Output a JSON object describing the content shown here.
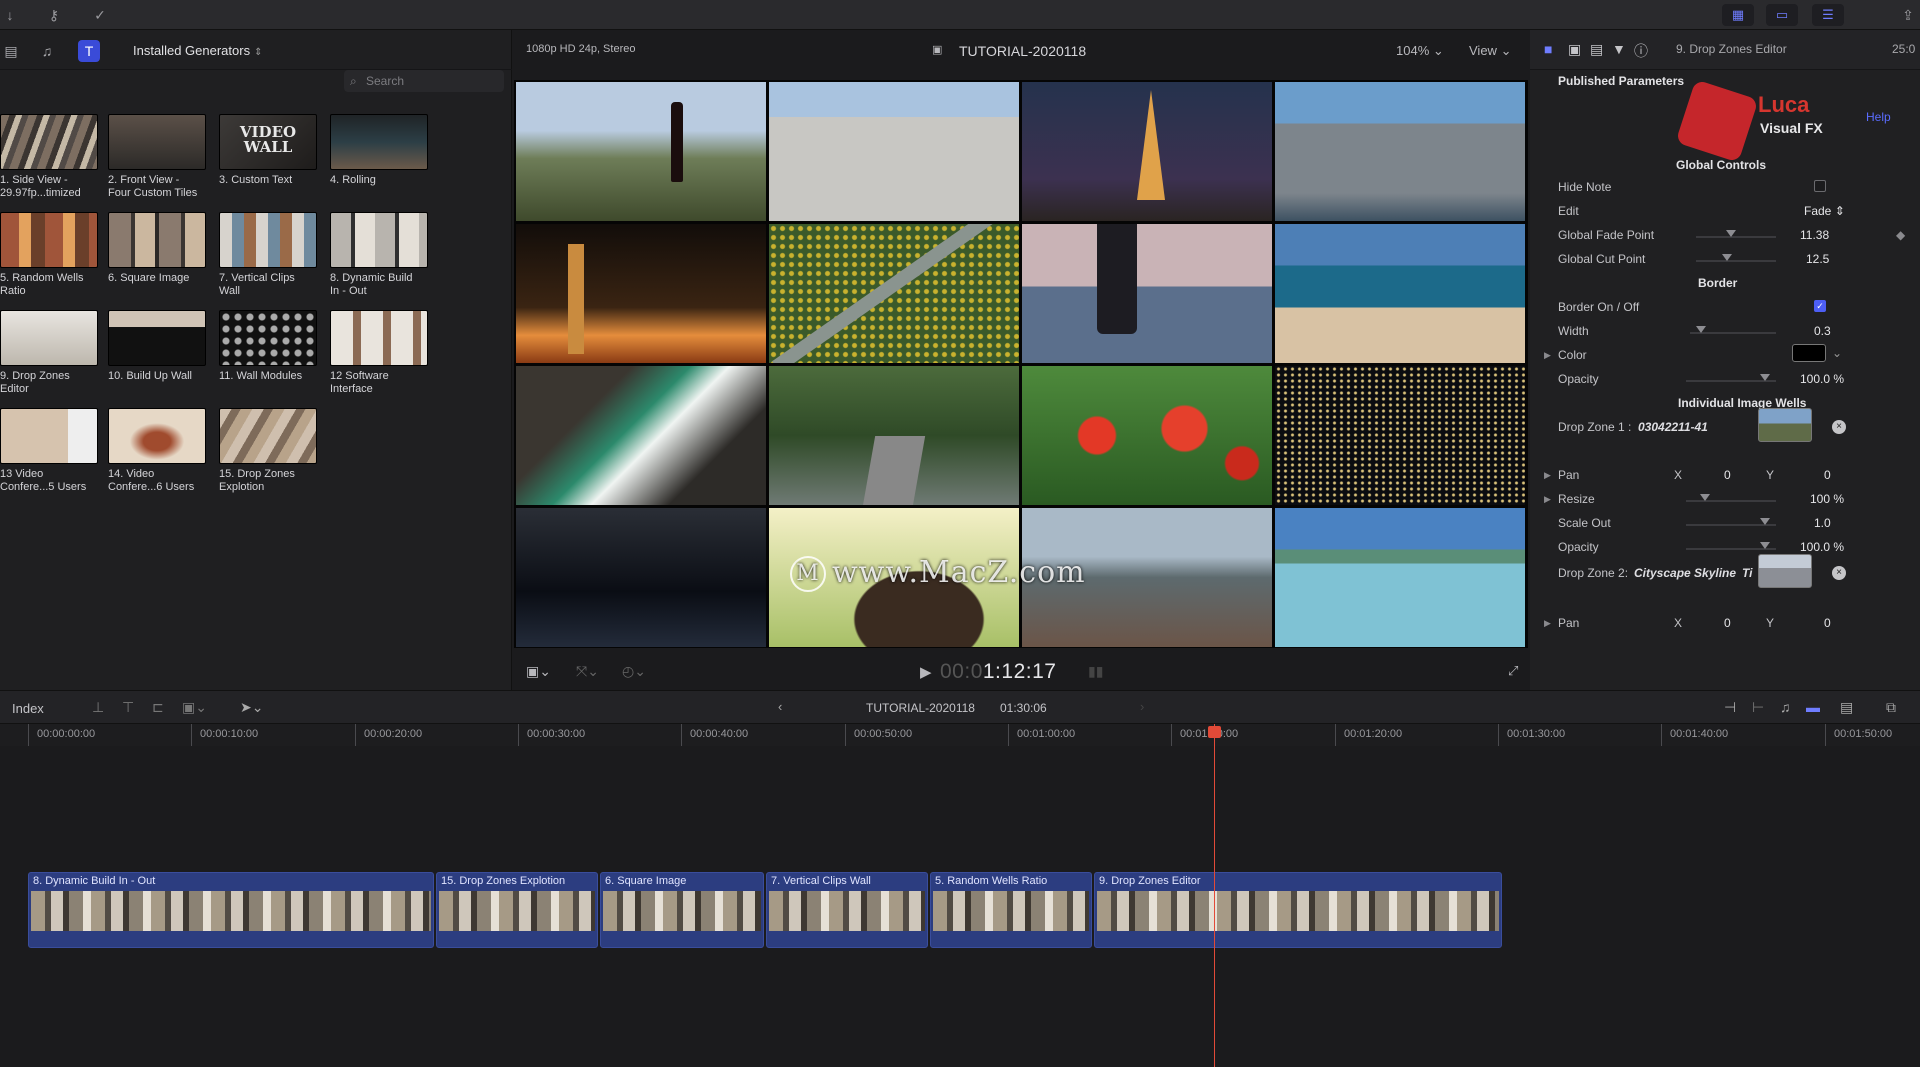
{
  "browser": {
    "category": "Installed Generators",
    "search_placeholder": "Search",
    "generators": [
      {
        "label": "1. Side View -\n29.97fp...timized"
      },
      {
        "label": "2. Front View -\nFour Custom Tiles"
      },
      {
        "label": "3. Custom Text",
        "thumb_text": "VIDEO WALL"
      },
      {
        "label": "4. Rolling"
      },
      {
        "label": "5. Random Wells\nRatio"
      },
      {
        "label": "6. Square Image"
      },
      {
        "label": "7. Vertical Clips\nWall"
      },
      {
        "label": "8. Dynamic Build\nIn - Out"
      },
      {
        "label": "9. Drop Zones\nEditor"
      },
      {
        "label": "10. Build Up Wall"
      },
      {
        "label": "11. Wall Modules"
      },
      {
        "label": "12 Software\nInterface"
      },
      {
        "label": "13 Video\nConfere...5 Users"
      },
      {
        "label": "14. Video\nConfere...6 Users"
      },
      {
        "label": "15. Drop Zones\nExplotion"
      }
    ]
  },
  "viewer": {
    "format": "1080p HD 24p, Stereo",
    "project": "TUTORIAL-2020118",
    "zoom": "104%",
    "view_menu": "View",
    "timecode_dim": "00:0",
    "timecode": "1:12:17",
    "watermark": "www.MacZ.com"
  },
  "inspector": {
    "title": "9. Drop Zones Editor",
    "duration": "25:0",
    "section": "Published Parameters",
    "brand_name": "Luca",
    "brand_sub": "Visual FX",
    "help": "Help",
    "global_controls": "Global Controls",
    "hide_note": "Hide Note",
    "edit_label": "Edit",
    "edit_value": "Fade",
    "global_fade_point": "Global Fade Point",
    "global_fade_value": "11.38",
    "global_cut_point": "Global Cut Point",
    "global_cut_value": "12.5",
    "border": "Border",
    "border_onoff": "Border On / Off",
    "width_label": "Width",
    "width_value": "0.3",
    "color_label": "Color",
    "opacity_label": "Opacity",
    "opacity_value": "100.0",
    "percent": "%",
    "wells": "Individual Image Wells",
    "dz1_label": "Drop Zone 1 :",
    "dz1_value": "03042211-41",
    "pan_label": "Pan",
    "x_label": "X",
    "y_label": "Y",
    "zero": "0",
    "resize_label": "Resize",
    "resize_value": "100",
    "scale_out_label": "Scale Out",
    "scale_out_value": "1.0",
    "opacity2_value": "100.0",
    "dz2_label": "Drop Zone 2:",
    "dz2_value": "Cityscape Skyline",
    "dz2_trunc": "Ti"
  },
  "timeline": {
    "index": "Index",
    "project": "TUTORIAL-2020118",
    "duration": "01:30:06",
    "ruler": [
      "00:00:00:00",
      "00:00:10:00",
      "00:00:20:00",
      "00:00:30:00",
      "00:00:40:00",
      "00:00:50:00",
      "00:01:00:00",
      "00:01:10:00",
      "00:01:20:00",
      "00:01:30:00",
      "00:01:40:00",
      "00:01:50:00"
    ],
    "clips": [
      {
        "name": "8. Dynamic Build In - Out"
      },
      {
        "name": "15. Drop Zones Explotion"
      },
      {
        "name": "6. Square Image"
      },
      {
        "name": "7. Vertical Clips Wall"
      },
      {
        "name": "5. Random Wells Ratio"
      },
      {
        "name": "9. Drop Zones Editor"
      }
    ]
  }
}
